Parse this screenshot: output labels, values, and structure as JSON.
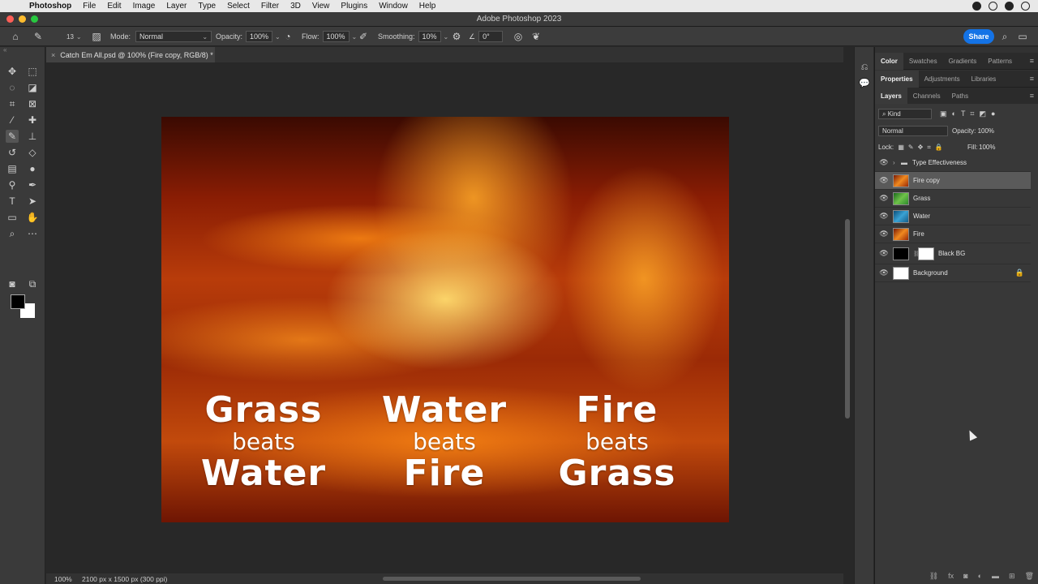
{
  "menubar": {
    "app": "Photoshop",
    "items": [
      "File",
      "Edit",
      "Image",
      "Layer",
      "Type",
      "Select",
      "Filter",
      "3D",
      "View",
      "Plugins",
      "Window",
      "Help"
    ]
  },
  "window": {
    "title": "Adobe Photoshop 2023"
  },
  "options": {
    "brush_size": "13",
    "mode_label": "Mode:",
    "mode_value": "Normal",
    "opacity_label": "Opacity:",
    "opacity_value": "100%",
    "flow_label": "Flow:",
    "flow_value": "100%",
    "smoothing_label": "Smoothing:",
    "smoothing_value": "10%",
    "angle_value": "0°",
    "share_label": "Share"
  },
  "document": {
    "tab_title": "Catch Em All.psd @ 100% (Fire copy, RGB/8) *",
    "zoom": "100%",
    "dimensions": "2100 px x 1500 px (300 ppi)"
  },
  "artwork": {
    "columns": [
      {
        "top": "Grass",
        "middle": "beats",
        "bottom": "Water"
      },
      {
        "top": "Water",
        "middle": "beats",
        "bottom": "Fire"
      },
      {
        "top": "Fire",
        "middle": "beats",
        "bottom": "Grass"
      }
    ]
  },
  "panels": {
    "row1": [
      "Color",
      "Swatches",
      "Gradients",
      "Patterns"
    ],
    "row2": [
      "Properties",
      "Adjustments",
      "Libraries"
    ],
    "row3": [
      "Layers",
      "Channels",
      "Paths"
    ]
  },
  "layers_panel": {
    "filter_label": "Kind",
    "blend_mode": "Normal",
    "opacity_label": "Opacity:",
    "opacity_value": "100%",
    "lock_label": "Lock:",
    "fill_label": "Fill:",
    "fill_value": "100%",
    "layers": [
      {
        "name": "Type Effectiveness",
        "kind": "group"
      },
      {
        "name": "Fire copy",
        "kind": "smart",
        "selected": true
      },
      {
        "name": "Grass",
        "kind": "smart"
      },
      {
        "name": "Water",
        "kind": "smart"
      },
      {
        "name": "Fire",
        "kind": "smart"
      },
      {
        "name": "Black BG",
        "kind": "masked"
      },
      {
        "name": "Background",
        "kind": "background",
        "locked": true
      }
    ]
  },
  "colors": {
    "share_button": "#1473e6",
    "foreground": "#000000",
    "background": "#ffffff"
  }
}
